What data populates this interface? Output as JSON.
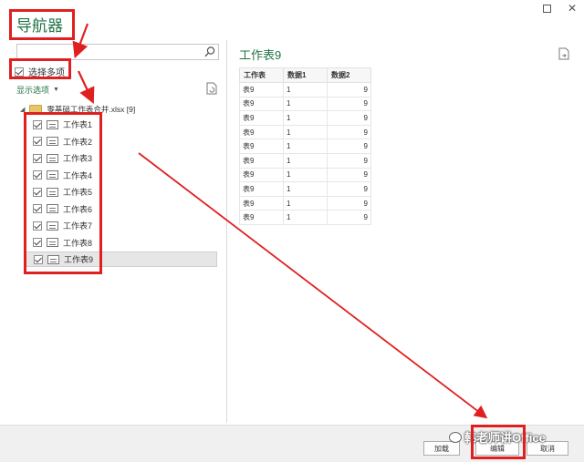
{
  "window": {
    "title": "导航器"
  },
  "search": {
    "placeholder": ""
  },
  "multi_select": {
    "label": "选择多项",
    "checked": true
  },
  "display_options": {
    "label": "显示选项"
  },
  "tree": {
    "root_label": "零基础工作表合并.xlsx [9]",
    "items": [
      {
        "label": "工作表1",
        "checked": true
      },
      {
        "label": "工作表2",
        "checked": true
      },
      {
        "label": "工作表3",
        "checked": true
      },
      {
        "label": "工作表4",
        "checked": true
      },
      {
        "label": "工作表5",
        "checked": true
      },
      {
        "label": "工作表6",
        "checked": true
      },
      {
        "label": "工作表7",
        "checked": true
      },
      {
        "label": "工作表8",
        "checked": true
      },
      {
        "label": "工作表9",
        "checked": true,
        "selected": true
      }
    ]
  },
  "preview": {
    "title": "工作表9",
    "columns": [
      "工作表",
      "数据1",
      "数据2"
    ],
    "rows": [
      [
        "表9",
        "1",
        "9"
      ],
      [
        "表9",
        "1",
        "9"
      ],
      [
        "表9",
        "1",
        "9"
      ],
      [
        "表9",
        "1",
        "9"
      ],
      [
        "表9",
        "1",
        "9"
      ],
      [
        "表9",
        "1",
        "9"
      ],
      [
        "表9",
        "1",
        "9"
      ],
      [
        "表9",
        "1",
        "9"
      ],
      [
        "表9",
        "1",
        "9"
      ],
      [
        "表9",
        "1",
        "9"
      ]
    ]
  },
  "footer": {
    "load_label": "加载",
    "edit_label": "编辑",
    "cancel_label": "取消"
  },
  "watermark": {
    "text": "韩老师讲Office"
  },
  "colors": {
    "accent": "#217346",
    "annotation": "#e02020"
  }
}
